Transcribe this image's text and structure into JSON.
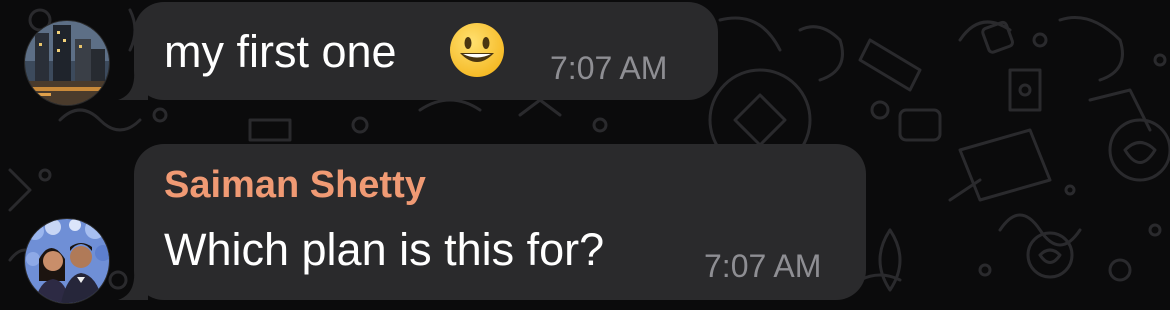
{
  "theme": {
    "background": "#0b0b0c",
    "bubble": "#2a2a2c",
    "text": "#ffffff",
    "timestamp": "#8e8e93",
    "sender_name": "#f09a74"
  },
  "messages": [
    {
      "avatar_icon": "avatar-city-night-photo",
      "text": "my first one",
      "emoji_icon": "grinning-face-emoji",
      "time": "7:07 AM"
    },
    {
      "avatar_icon": "avatar-couple-photo",
      "sender": "Saiman Shetty",
      "text": "Which plan is this for?",
      "time": "7:07 AM"
    }
  ]
}
